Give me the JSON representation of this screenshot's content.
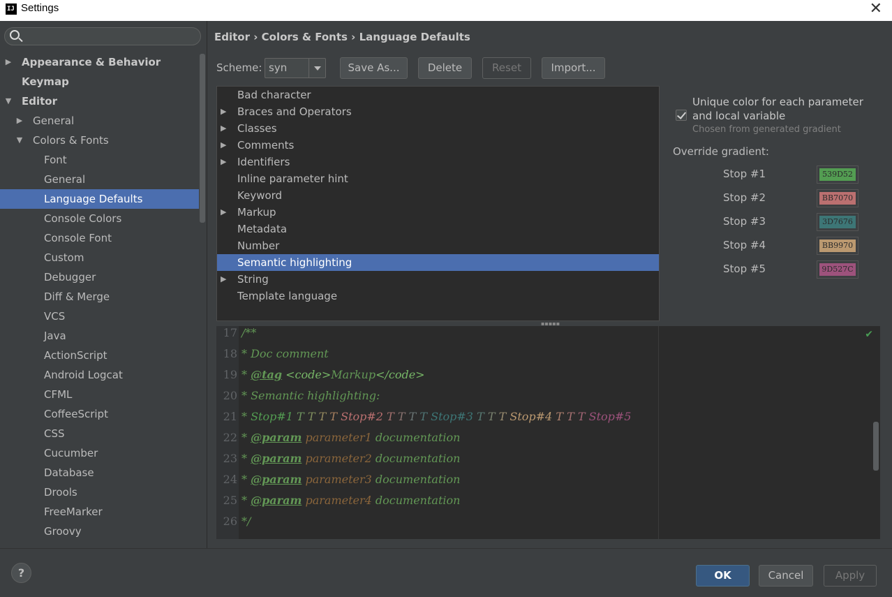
{
  "window": {
    "title": "Settings",
    "app_icon": "IJ"
  },
  "search": {
    "placeholder": ""
  },
  "tree": [
    {
      "label": "Appearance & Behavior",
      "arrow": "▶",
      "indent": 0,
      "bold": true,
      "selected": false
    },
    {
      "label": "Keymap",
      "arrow": "",
      "indent": 0,
      "bold": true,
      "selected": false
    },
    {
      "label": "Editor",
      "arrow": "▼",
      "indent": 0,
      "bold": true,
      "selected": false
    },
    {
      "label": "General",
      "arrow": "▶",
      "indent": 1,
      "bold": false,
      "selected": false
    },
    {
      "label": "Colors & Fonts",
      "arrow": "▼",
      "indent": 1,
      "bold": false,
      "selected": false
    },
    {
      "label": "Font",
      "arrow": "",
      "indent": 2,
      "bold": false,
      "selected": false
    },
    {
      "label": "General",
      "arrow": "",
      "indent": 2,
      "bold": false,
      "selected": false
    },
    {
      "label": "Language Defaults",
      "arrow": "",
      "indent": 2,
      "bold": false,
      "selected": true
    },
    {
      "label": "Console Colors",
      "arrow": "",
      "indent": 2,
      "bold": false,
      "selected": false
    },
    {
      "label": "Console Font",
      "arrow": "",
      "indent": 2,
      "bold": false,
      "selected": false
    },
    {
      "label": "Custom",
      "arrow": "",
      "indent": 2,
      "bold": false,
      "selected": false
    },
    {
      "label": "Debugger",
      "arrow": "",
      "indent": 2,
      "bold": false,
      "selected": false
    },
    {
      "label": "Diff & Merge",
      "arrow": "",
      "indent": 2,
      "bold": false,
      "selected": false
    },
    {
      "label": "VCS",
      "arrow": "",
      "indent": 2,
      "bold": false,
      "selected": false
    },
    {
      "label": "Java",
      "arrow": "",
      "indent": 2,
      "bold": false,
      "selected": false
    },
    {
      "label": "ActionScript",
      "arrow": "",
      "indent": 2,
      "bold": false,
      "selected": false
    },
    {
      "label": "Android Logcat",
      "arrow": "",
      "indent": 2,
      "bold": false,
      "selected": false
    },
    {
      "label": "CFML",
      "arrow": "",
      "indent": 2,
      "bold": false,
      "selected": false
    },
    {
      "label": "CoffeeScript",
      "arrow": "",
      "indent": 2,
      "bold": false,
      "selected": false
    },
    {
      "label": "CSS",
      "arrow": "",
      "indent": 2,
      "bold": false,
      "selected": false
    },
    {
      "label": "Cucumber",
      "arrow": "",
      "indent": 2,
      "bold": false,
      "selected": false
    },
    {
      "label": "Database",
      "arrow": "",
      "indent": 2,
      "bold": false,
      "selected": false
    },
    {
      "label": "Drools",
      "arrow": "",
      "indent": 2,
      "bold": false,
      "selected": false
    },
    {
      "label": "FreeMarker",
      "arrow": "",
      "indent": 2,
      "bold": false,
      "selected": false
    },
    {
      "label": "Groovy",
      "arrow": "",
      "indent": 2,
      "bold": false,
      "selected": false
    }
  ],
  "breadcrumb": "Editor › Colors & Fonts › Language Defaults",
  "scheme": {
    "label": "Scheme:",
    "value": "syn",
    "save_as": "Save As...",
    "delete": "Delete",
    "reset": "Reset",
    "import": "Import..."
  },
  "categories": [
    {
      "label": "Bad character",
      "expandable": false,
      "selected": false
    },
    {
      "label": "Braces and Operators",
      "expandable": true,
      "selected": false
    },
    {
      "label": "Classes",
      "expandable": true,
      "selected": false
    },
    {
      "label": "Comments",
      "expandable": true,
      "selected": false
    },
    {
      "label": "Identifiers",
      "expandable": true,
      "selected": false
    },
    {
      "label": "Inline parameter hint",
      "expandable": false,
      "selected": false
    },
    {
      "label": "Keyword",
      "expandable": false,
      "selected": false
    },
    {
      "label": "Markup",
      "expandable": true,
      "selected": false
    },
    {
      "label": "Metadata",
      "expandable": false,
      "selected": false
    },
    {
      "label": "Number",
      "expandable": false,
      "selected": false
    },
    {
      "label": "Semantic highlighting",
      "expandable": false,
      "selected": true
    },
    {
      "label": "String",
      "expandable": true,
      "selected": false
    },
    {
      "label": "Template language",
      "expandable": false,
      "selected": false
    }
  ],
  "options": {
    "unique_color_label": "Unique color for each parameter and local variable",
    "unique_color_checked": true,
    "hint": "Chosen from generated gradient",
    "override_label": "Override gradient:",
    "stops": [
      {
        "label": "Stop #1",
        "hex": "539D52",
        "color": "#539D52"
      },
      {
        "label": "Stop #2",
        "hex": "BB7070",
        "color": "#BB7070"
      },
      {
        "label": "Stop #3",
        "hex": "3D7676",
        "color": "#3D7676"
      },
      {
        "label": "Stop #4",
        "hex": "BB9970",
        "color": "#BB9970"
      },
      {
        "label": "Stop #5",
        "hex": "9D527C",
        "color": "#9D527C"
      }
    ]
  },
  "preview": {
    "lines": [
      {
        "num": "17",
        "html": "/**"
      },
      {
        "num": "18",
        "html": " * Doc comment"
      },
      {
        "num": "19",
        "html": " * <span class=\"tag\">@tag</span> <span class=\"markup\">&lt;code&gt;</span>Markup<span class=\"markup\">&lt;/code&gt;</span>"
      },
      {
        "num": "20",
        "html": " * Semantic highlighting:"
      },
      {
        "num": "21",
        "html": " * <span style=\"color:#539D52\">Stop#1</span> <span style=\"color:#6f9560\">T</span> <span style=\"color:#82905f\">T</span> <span style=\"color:#958a5f\">T</span> <span style=\"color:#a8805f\">T</span> <span style=\"color:#BB7070\">Stop#2</span> <span style=\"color:#a5726f\">T</span> <span style=\"color:#8a7370\">T</span> <span style=\"color:#6a7474\">T</span> <span style=\"color:#4f7575\">T</span> <span style=\"color:#3D7676\">Stop#3</span> <span style=\"color:#587a73\">T</span> <span style=\"color:#7a8270\">T</span> <span style=\"color:#998c70\">T</span> <span style=\"color:#BB9970\">Stop#4</span> <span style=\"color:#b0826f\">T</span> <span style=\"color:#a97373\">T</span> <span style=\"color:#a46676\">T</span> <span style=\"color:#9D527C\">Stop#5</span>"
      },
      {
        "num": "22",
        "html": " * <span class=\"tag\">@param</span> <span class=\"pname\">parameter1</span> documentation"
      },
      {
        "num": "23",
        "html": " * <span class=\"tag\">@param</span> <span class=\"pname\">parameter2</span> documentation"
      },
      {
        "num": "24",
        "html": " * <span class=\"tag\">@param</span> <span class=\"pname\">parameter3</span> documentation"
      },
      {
        "num": "25",
        "html": " * <span class=\"tag\">@param</span> <span class=\"pname\">parameter4</span> documentation"
      },
      {
        "num": "26",
        "html": " */"
      }
    ]
  },
  "footer": {
    "help": "?",
    "ok": "OK",
    "cancel": "Cancel",
    "apply": "Apply"
  }
}
